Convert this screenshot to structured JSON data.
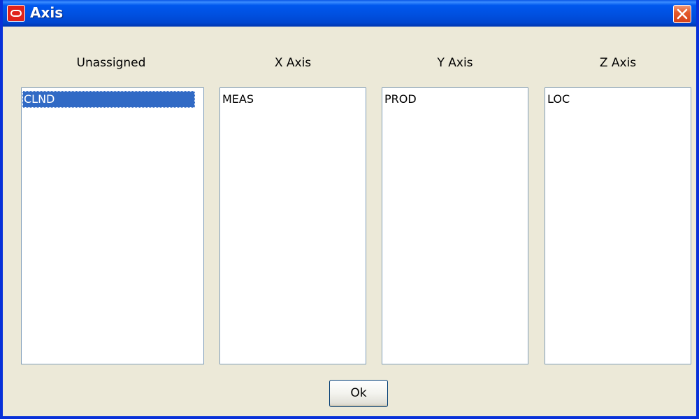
{
  "window": {
    "title": "Axis",
    "icon": "oracle-logo-icon",
    "close_icon": "close-icon",
    "accent_color": "#0054e3"
  },
  "columns": [
    {
      "label": "Unassigned",
      "items": [
        {
          "text": "CLND",
          "selected": true
        }
      ]
    },
    {
      "label": "X Axis",
      "items": [
        {
          "text": "MEAS",
          "selected": false
        }
      ]
    },
    {
      "label": "Y Axis",
      "items": [
        {
          "text": "PROD",
          "selected": false
        }
      ]
    },
    {
      "label": "Z Axis",
      "items": [
        {
          "text": "LOC",
          "selected": false
        }
      ]
    }
  ],
  "buttons": {
    "ok_label": "Ok"
  }
}
